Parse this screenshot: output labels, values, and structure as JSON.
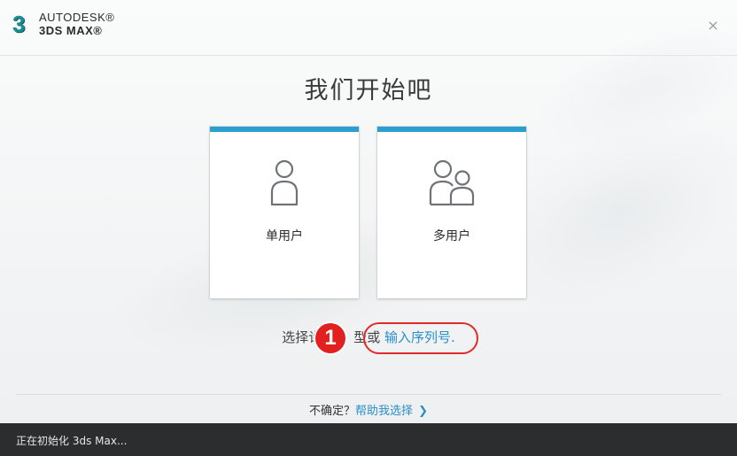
{
  "header": {
    "logo_mark": "3",
    "brand": "AUTODESK®",
    "product": "3DS MAX®",
    "close_glyph": "×"
  },
  "main": {
    "title": "我们开始吧",
    "cards": [
      {
        "label": "单用户",
        "icon": "single-user-icon"
      },
      {
        "label": "多用户",
        "icon": "multi-user-icon"
      }
    ],
    "license_prompt_before": "选择许",
    "license_prompt_after": "型或 ",
    "serial_link": "输入序列号.",
    "callout_number": "1"
  },
  "footer": {
    "unsure_text": "不确定？",
    "help_link": "帮助我选择",
    "help_chevron": "❯"
  },
  "statusbar": {
    "text": "正在初始化 3ds Max..."
  },
  "colors": {
    "accent": "#2a9fd0",
    "link": "#2a8fc6",
    "callout": "#e12b2b",
    "statusbar": "#2b2d2f"
  }
}
